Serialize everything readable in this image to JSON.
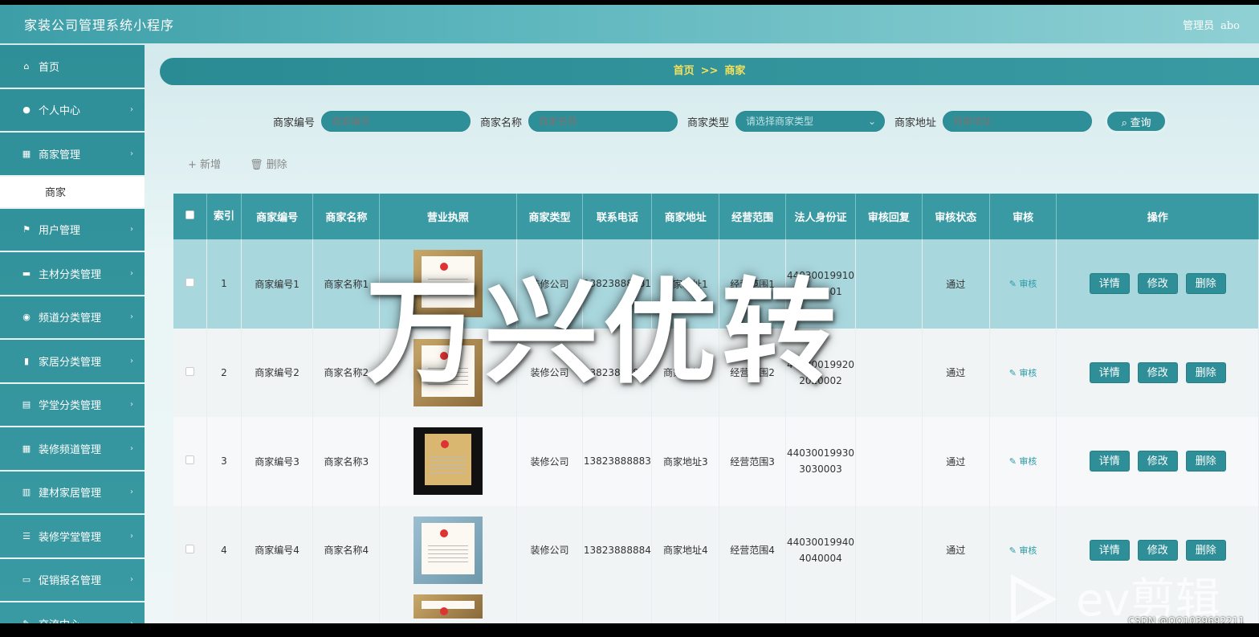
{
  "app": {
    "title": "家装公司管理系统小程序",
    "user_label": "管理员",
    "user_name": "abo"
  },
  "sidebar": {
    "items": [
      {
        "label": "首页",
        "icon": "home-icon"
      },
      {
        "label": "个人中心",
        "icon": "user-icon"
      },
      {
        "label": "商家管理",
        "icon": "grid-icon",
        "sub": "商家"
      },
      {
        "label": "用户管理",
        "icon": "flag-icon"
      },
      {
        "label": "主材分类管理",
        "icon": "briefcase-icon"
      },
      {
        "label": "频道分类管理",
        "icon": "globe-icon"
      },
      {
        "label": "家居分类管理",
        "icon": "bar-chart-icon"
      },
      {
        "label": "学堂分类管理",
        "icon": "clipboard-icon"
      },
      {
        "label": "装修频道管理",
        "icon": "grid-icon"
      },
      {
        "label": "建材家居管理",
        "icon": "document-icon"
      },
      {
        "label": "装修学堂管理",
        "icon": "sliders-icon"
      },
      {
        "label": "促销报名管理",
        "icon": "monitor-icon"
      },
      {
        "label": "交流中心",
        "icon": "chat-icon"
      }
    ]
  },
  "breadcrumb": {
    "home": "首页",
    "sep": ">>",
    "current": "商家"
  },
  "search": {
    "merchant_no_label": "商家编号",
    "merchant_no_placeholder": "商家编号",
    "merchant_name_label": "商家名称",
    "merchant_name_placeholder": "商家名称",
    "merchant_type_label": "商家类型",
    "merchant_type_placeholder": "请选择商家类型",
    "merchant_addr_label": "商家地址",
    "merchant_addr_placeholder": "商家地址",
    "query_label": "查询"
  },
  "toolbar": {
    "add_label": "新增",
    "delete_label": "删除"
  },
  "table": {
    "headers": [
      "索引",
      "商家编号",
      "商家名称",
      "营业执照",
      "商家类型",
      "联系电话",
      "商家地址",
      "经营范围",
      "法人身份证",
      "审核回复",
      "审核状态",
      "审核",
      "操作"
    ],
    "rows": [
      {
        "index": "1",
        "no": "商家编号1",
        "name": "商家名称1",
        "type": "装修公司",
        "phone": "13823888881",
        "addr": "商家地址1",
        "scope": "经营范围1",
        "id_a": "44030019910",
        "id_b": "1010001",
        "reply": "",
        "status": "通过",
        "audit": "审核"
      },
      {
        "index": "2",
        "no": "商家编号2",
        "name": "商家名称2",
        "type": "装修公司",
        "phone": "13823888882",
        "addr": "商家地址2",
        "scope": "经营范围2",
        "id_a": "44030019920",
        "id_b": "2020002",
        "reply": "",
        "status": "通过",
        "audit": "审核"
      },
      {
        "index": "3",
        "no": "商家编号3",
        "name": "商家名称3",
        "type": "装修公司",
        "phone": "13823888883",
        "addr": "商家地址3",
        "scope": "经营范围3",
        "id_a": "44030019930",
        "id_b": "3030003",
        "reply": "",
        "status": "通过",
        "audit": "审核"
      },
      {
        "index": "4",
        "no": "商家编号4",
        "name": "商家名称4",
        "type": "装修公司",
        "phone": "13823888884",
        "addr": "商家地址4",
        "scope": "经营范围4",
        "id_a": "44030019940",
        "id_b": "4040004",
        "reply": "",
        "status": "通过",
        "audit": "审核"
      }
    ],
    "actions": {
      "detail": "详情",
      "edit": "修改",
      "delete": "删除"
    }
  },
  "overlay": {
    "watermark": "万兴优转",
    "ev_text": "ev剪辑",
    "csdn": "CSDN @QQ1039692211"
  }
}
